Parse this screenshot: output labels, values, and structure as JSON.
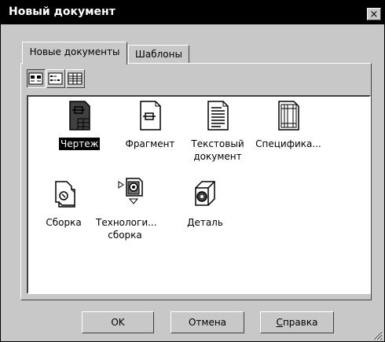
{
  "window": {
    "title": "Новый документ",
    "close_symbol": "×"
  },
  "tabs": [
    {
      "label": "Новые документы",
      "active": true
    },
    {
      "label": "Шаблоны",
      "active": false
    }
  ],
  "view_buttons": [
    {
      "icon": "large-icons-view-icon",
      "pressed": true
    },
    {
      "icon": "list-view-icon",
      "pressed": false
    },
    {
      "icon": "details-view-icon",
      "pressed": false
    }
  ],
  "items": [
    {
      "label": "Чертеж",
      "icon": "drawing-icon",
      "selected": true
    },
    {
      "label": "Фрагмент",
      "icon": "fragment-icon",
      "selected": false
    },
    {
      "label": "Текстовый документ",
      "icon": "text-document-icon",
      "selected": false
    },
    {
      "label": "Специфика...",
      "icon": "specification-icon",
      "selected": false
    },
    {
      "label": "Сборка",
      "icon": "assembly-icon",
      "selected": false
    },
    {
      "label": "Технологи... сборка",
      "icon": "tech-assembly-icon",
      "selected": false
    },
    {
      "label": "Деталь",
      "icon": "part-icon",
      "selected": false
    }
  ],
  "buttons": {
    "ok": "OK",
    "cancel": "Отмена",
    "help_first": "С",
    "help_rest": "правка"
  },
  "colors": {
    "dialog_face": "#c8c8c8",
    "titlebar": "#000000",
    "selection": "#000000"
  }
}
